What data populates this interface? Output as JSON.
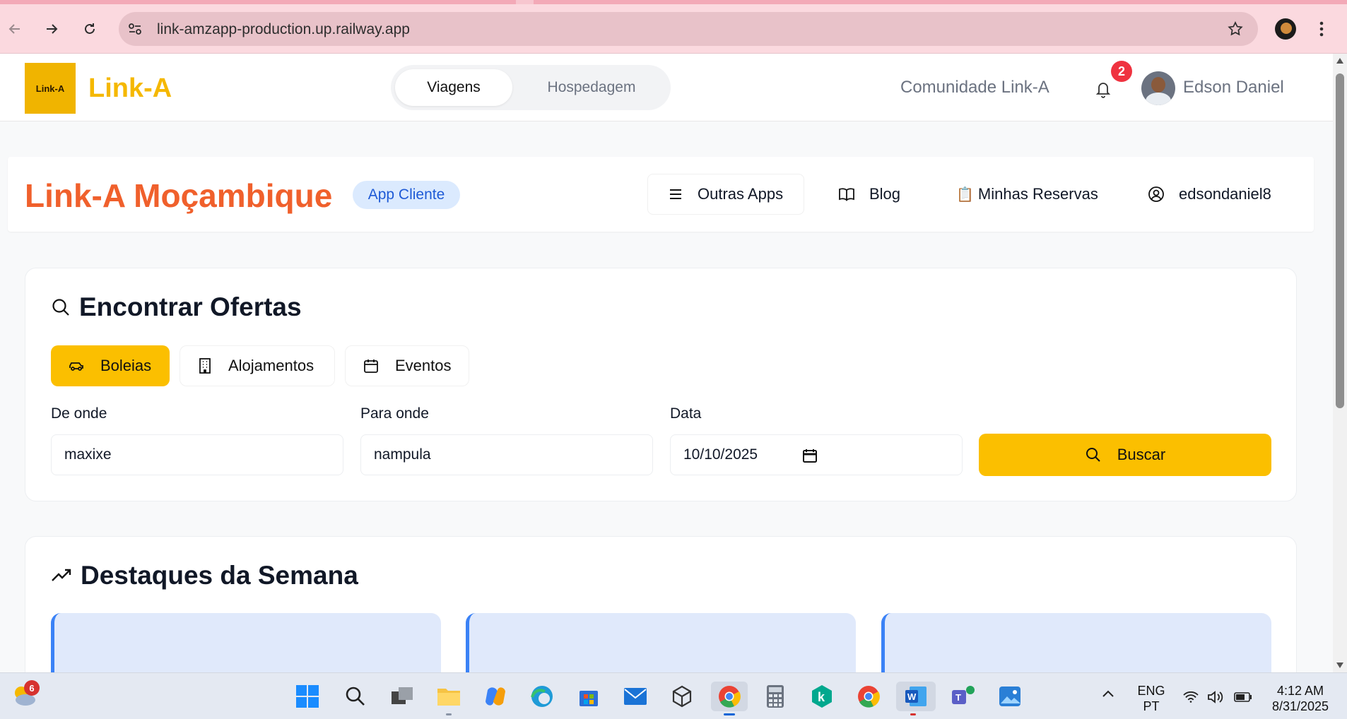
{
  "browser": {
    "url": "link-amzapp-production.up.railway.app"
  },
  "header": {
    "logo_text": "Link-A",
    "brand": "Link-A",
    "tabs": [
      {
        "label": "Viagens",
        "active": true
      },
      {
        "label": "Hospedagem",
        "active": false
      }
    ],
    "community": "Comunidade Link-A",
    "notifications_count": "2",
    "user_name": "Edson Daniel"
  },
  "subbar": {
    "title": "Link-A Moçambique",
    "badge": "App Cliente",
    "links": {
      "other_apps": "Outras Apps",
      "blog": "Blog",
      "reservations": "Minhas Reservas",
      "username": "edsondaniel8"
    }
  },
  "search": {
    "heading": "Encontrar Ofertas",
    "categories": [
      {
        "label": "Boleias",
        "icon": "car-icon",
        "active": true
      },
      {
        "label": "Alojamentos",
        "icon": "building-icon",
        "active": false
      },
      {
        "label": "Eventos",
        "icon": "calendar-icon",
        "active": false
      }
    ],
    "from_label": "De onde",
    "from_value": "maxixe",
    "to_label": "Para onde",
    "to_value": "nampula",
    "date_label": "Data",
    "date_value": "10/10/2025",
    "button_label": "Buscar"
  },
  "highlights": {
    "heading": "Destaques da Semana"
  },
  "taskbar": {
    "weather_badge": "6",
    "lang_top": "ENG",
    "lang_bottom": "PT",
    "time": "4:12 AM",
    "date": "8/31/2025"
  },
  "colors": {
    "brand_yellow": "#fbbf00",
    "title_orange": "#f0602c",
    "badge_blue": "#1e5ad6",
    "notification_red": "#ef3340",
    "chrome_pink": "#fbd9df"
  }
}
